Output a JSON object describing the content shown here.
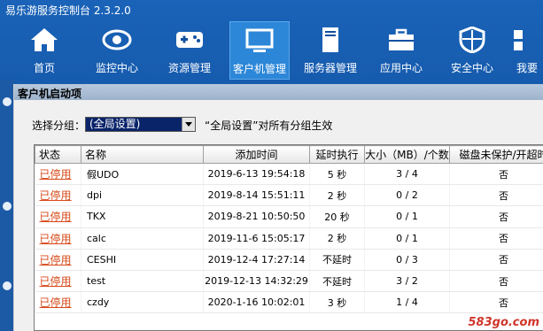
{
  "app": {
    "title": "易乐游服务控制台 2.3.2.0"
  },
  "toolbar": [
    {
      "label": "首页",
      "icon": "home-icon"
    },
    {
      "label": "监控中心",
      "icon": "eye-icon"
    },
    {
      "label": "资源管理",
      "icon": "gamepad-icon"
    },
    {
      "label": "客户机管理",
      "icon": "monitor-icon",
      "active": true
    },
    {
      "label": "服务器管理",
      "icon": "server-icon"
    },
    {
      "label": "应用中心",
      "icon": "toolbox-icon"
    },
    {
      "label": "安全中心",
      "icon": "shield-icon"
    },
    {
      "label": "我要",
      "icon": "grid-icon"
    }
  ],
  "dialog": {
    "title": "客户机启动项",
    "group_label": "选择分组：",
    "group_value": "(全局设置)",
    "group_note": "“全局设置”对所有分组生效"
  },
  "table": {
    "columns": [
      "状态",
      "名称",
      "添加时间",
      "延时执行",
      "大小（MB）/个数",
      "磁盘未保护/开超时"
    ],
    "rows": [
      {
        "status": "已停用",
        "name": "假UDO",
        "time": "2019-6-13 19:54:18",
        "delay": "5 秒",
        "size": "3 / 4",
        "disk": "否"
      },
      {
        "status": "已停用",
        "name": "dpi",
        "time": "2019-8-14 15:51:11",
        "delay": "2 秒",
        "size": "0 / 2",
        "disk": "否"
      },
      {
        "status": "已停用",
        "name": "TKX",
        "time": "2019-8-21 10:50:50",
        "delay": "20 秒",
        "size": "0 / 1",
        "disk": "否"
      },
      {
        "status": "已停用",
        "name": "calc",
        "time": "2019-11-6 15:05:17",
        "delay": "2 秒",
        "size": "0 / 1",
        "disk": "否"
      },
      {
        "status": "已停用",
        "name": "CESHI",
        "time": "2019-12-4 17:27:14",
        "delay": "不延时",
        "size": "0 / 3",
        "disk": "否"
      },
      {
        "status": "已停用",
        "name": "test",
        "time": "2019-12-13 14:32:29",
        "delay": "不延时",
        "size": "3 / 2",
        "disk": "否"
      },
      {
        "status": "已停用",
        "name": "czdy",
        "time": "2020-1-16 10:02:01",
        "delay": "3 秒",
        "size": "1 / 4",
        "disk": "否"
      }
    ]
  },
  "watermark": "583go.com",
  "colors": {
    "status_link": "#d84a1a",
    "toolbar_bg": "#11509f",
    "active_tab": "#2d87d8",
    "selected_combo": "#0a246a"
  }
}
